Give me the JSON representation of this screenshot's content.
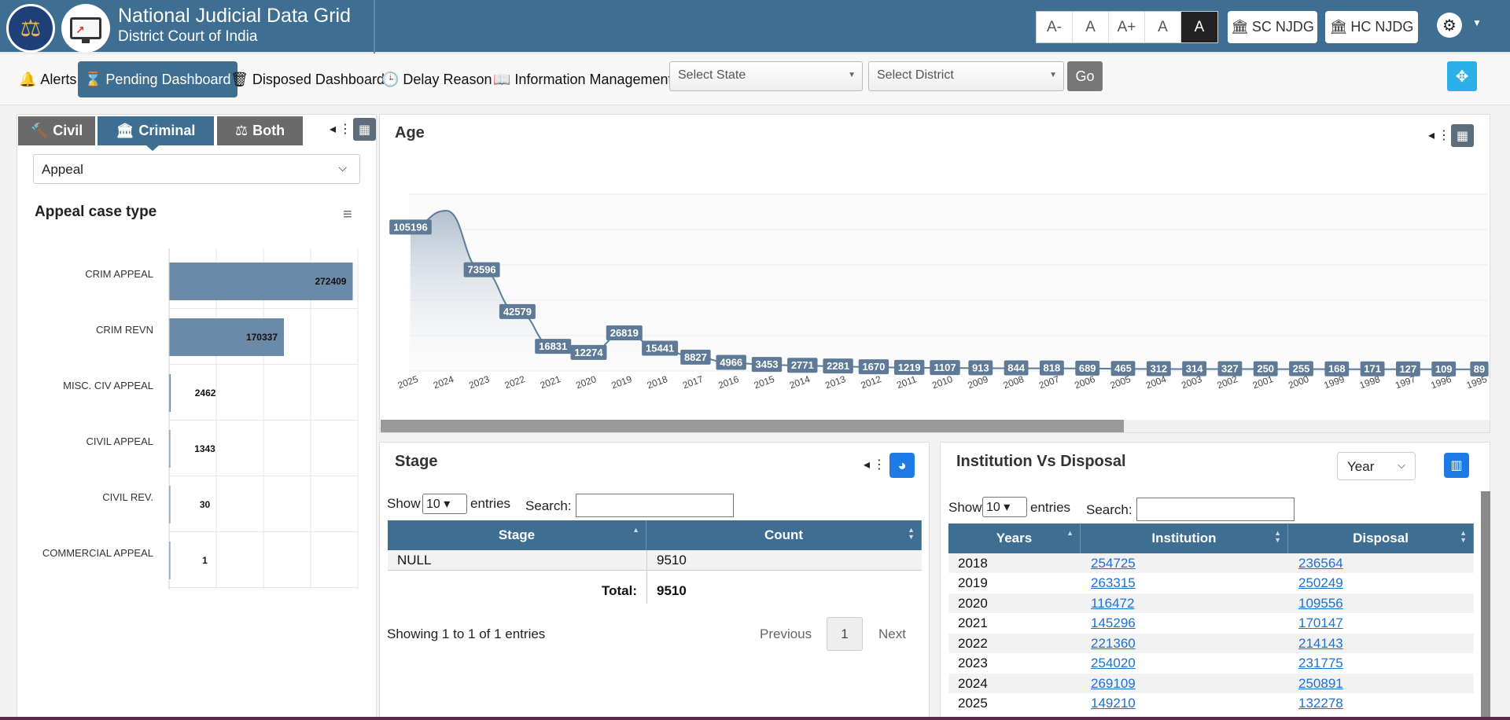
{
  "header": {
    "emblem_icon": "scales-of-justice-emblem-icon",
    "logo_icon": "monitor-chart-icon",
    "title": "National Judicial Data Grid",
    "subtitle": "District Court of India",
    "font_buttons": [
      "A-",
      "A",
      "A+",
      "A",
      "A"
    ],
    "sc_btn": "SC NJDG",
    "hc_btn": "HC NJDG",
    "settings_icon": "gear-icon"
  },
  "nav": {
    "alerts": "Alerts",
    "pending": "Pending Dashboard",
    "disposed": "Disposed Dashboard",
    "delay": "Delay Reason",
    "info": "Information Management",
    "state_placeholder": "Select State",
    "district_placeholder": "Select District",
    "go": "Go"
  },
  "left": {
    "tabs": {
      "civil": "Civil",
      "criminal": "Criminal",
      "both": "Both"
    },
    "select_value": "Appeal",
    "chart_title": "Appeal case type"
  },
  "age": {
    "title": "Age"
  },
  "stage": {
    "title": "Stage",
    "show": "Show",
    "entries_value": "10",
    "entries": "entries",
    "search": "Search:",
    "col_stage": "Stage",
    "col_count": "Count",
    "rows": [
      {
        "stage": "NULL",
        "count": "9510"
      }
    ],
    "total_label": "Total:",
    "total_value": "9510",
    "info": "Showing 1 to 1 of 1 entries",
    "prev": "Previous",
    "page": "1",
    "next": "Next"
  },
  "inst": {
    "title": "Institution Vs Disposal",
    "year_select": "Year",
    "show": "Show",
    "entries_value": "10",
    "entries": "entries",
    "search": "Search:",
    "col_years": "Years",
    "col_inst": "Institution",
    "col_disp": "Disposal",
    "rows": [
      {
        "year": "2018",
        "inst": "254725",
        "disp": "236564"
      },
      {
        "year": "2019",
        "inst": "263315",
        "disp": "250249"
      },
      {
        "year": "2020",
        "inst": "116472",
        "disp": "109556"
      },
      {
        "year": "2021",
        "inst": "145296",
        "disp": "170147"
      },
      {
        "year": "2022",
        "inst": "221360",
        "disp": "214143"
      },
      {
        "year": "2023",
        "inst": "254020",
        "disp": "231775"
      },
      {
        "year": "2024",
        "inst": "269109",
        "disp": "250891"
      },
      {
        "year": "2025",
        "inst": "149210",
        "disp": "132278"
      }
    ]
  },
  "colors": {
    "primary": "#3f6e93",
    "accent": "#1e7be6",
    "bar": "#6a8aa8"
  },
  "chart_data": [
    {
      "type": "bar",
      "orientation": "horizontal",
      "title": "Appeal case type",
      "categories": [
        "CRIM APPEAL",
        "CRIM REVN",
        "MISC. CIV APPEAL",
        "CIVIL APPEAL",
        "CIVIL REV.",
        "COMMERCIAL APPEAL"
      ],
      "values": [
        272409,
        170337,
        2462,
        1343,
        30,
        1
      ],
      "xlim": [
        0,
        280000
      ]
    },
    {
      "type": "area",
      "title": "Age",
      "categories": [
        "2025",
        "2024",
        "2023",
        "2022",
        "2021",
        "2020",
        "2019",
        "2018",
        "2017",
        "2016",
        "2015",
        "2014",
        "2013",
        "2012",
        "2011",
        "2010",
        "2009",
        "2008",
        "2007",
        "2006",
        "2005",
        "2004",
        "2003",
        "2002",
        "2001",
        "2000",
        "1999",
        "1998",
        "1997",
        "1996",
        "1995"
      ],
      "values": [
        105196,
        122000,
        73596,
        42579,
        16831,
        12274,
        26819,
        15441,
        8827,
        4966,
        3453,
        2771,
        2281,
        1670,
        1219,
        1107,
        913,
        844,
        818,
        689,
        465,
        312,
        314,
        327,
        250,
        255,
        168,
        171,
        127,
        109,
        89
      ],
      "labeled": [
        true,
        false,
        true,
        true,
        true,
        true,
        true,
        true,
        true,
        true,
        true,
        true,
        true,
        true,
        true,
        true,
        true,
        true,
        true,
        true,
        true,
        true,
        true,
        true,
        true,
        true,
        true,
        true,
        true,
        true,
        true
      ],
      "ylim": [
        0,
        150000
      ]
    }
  ]
}
